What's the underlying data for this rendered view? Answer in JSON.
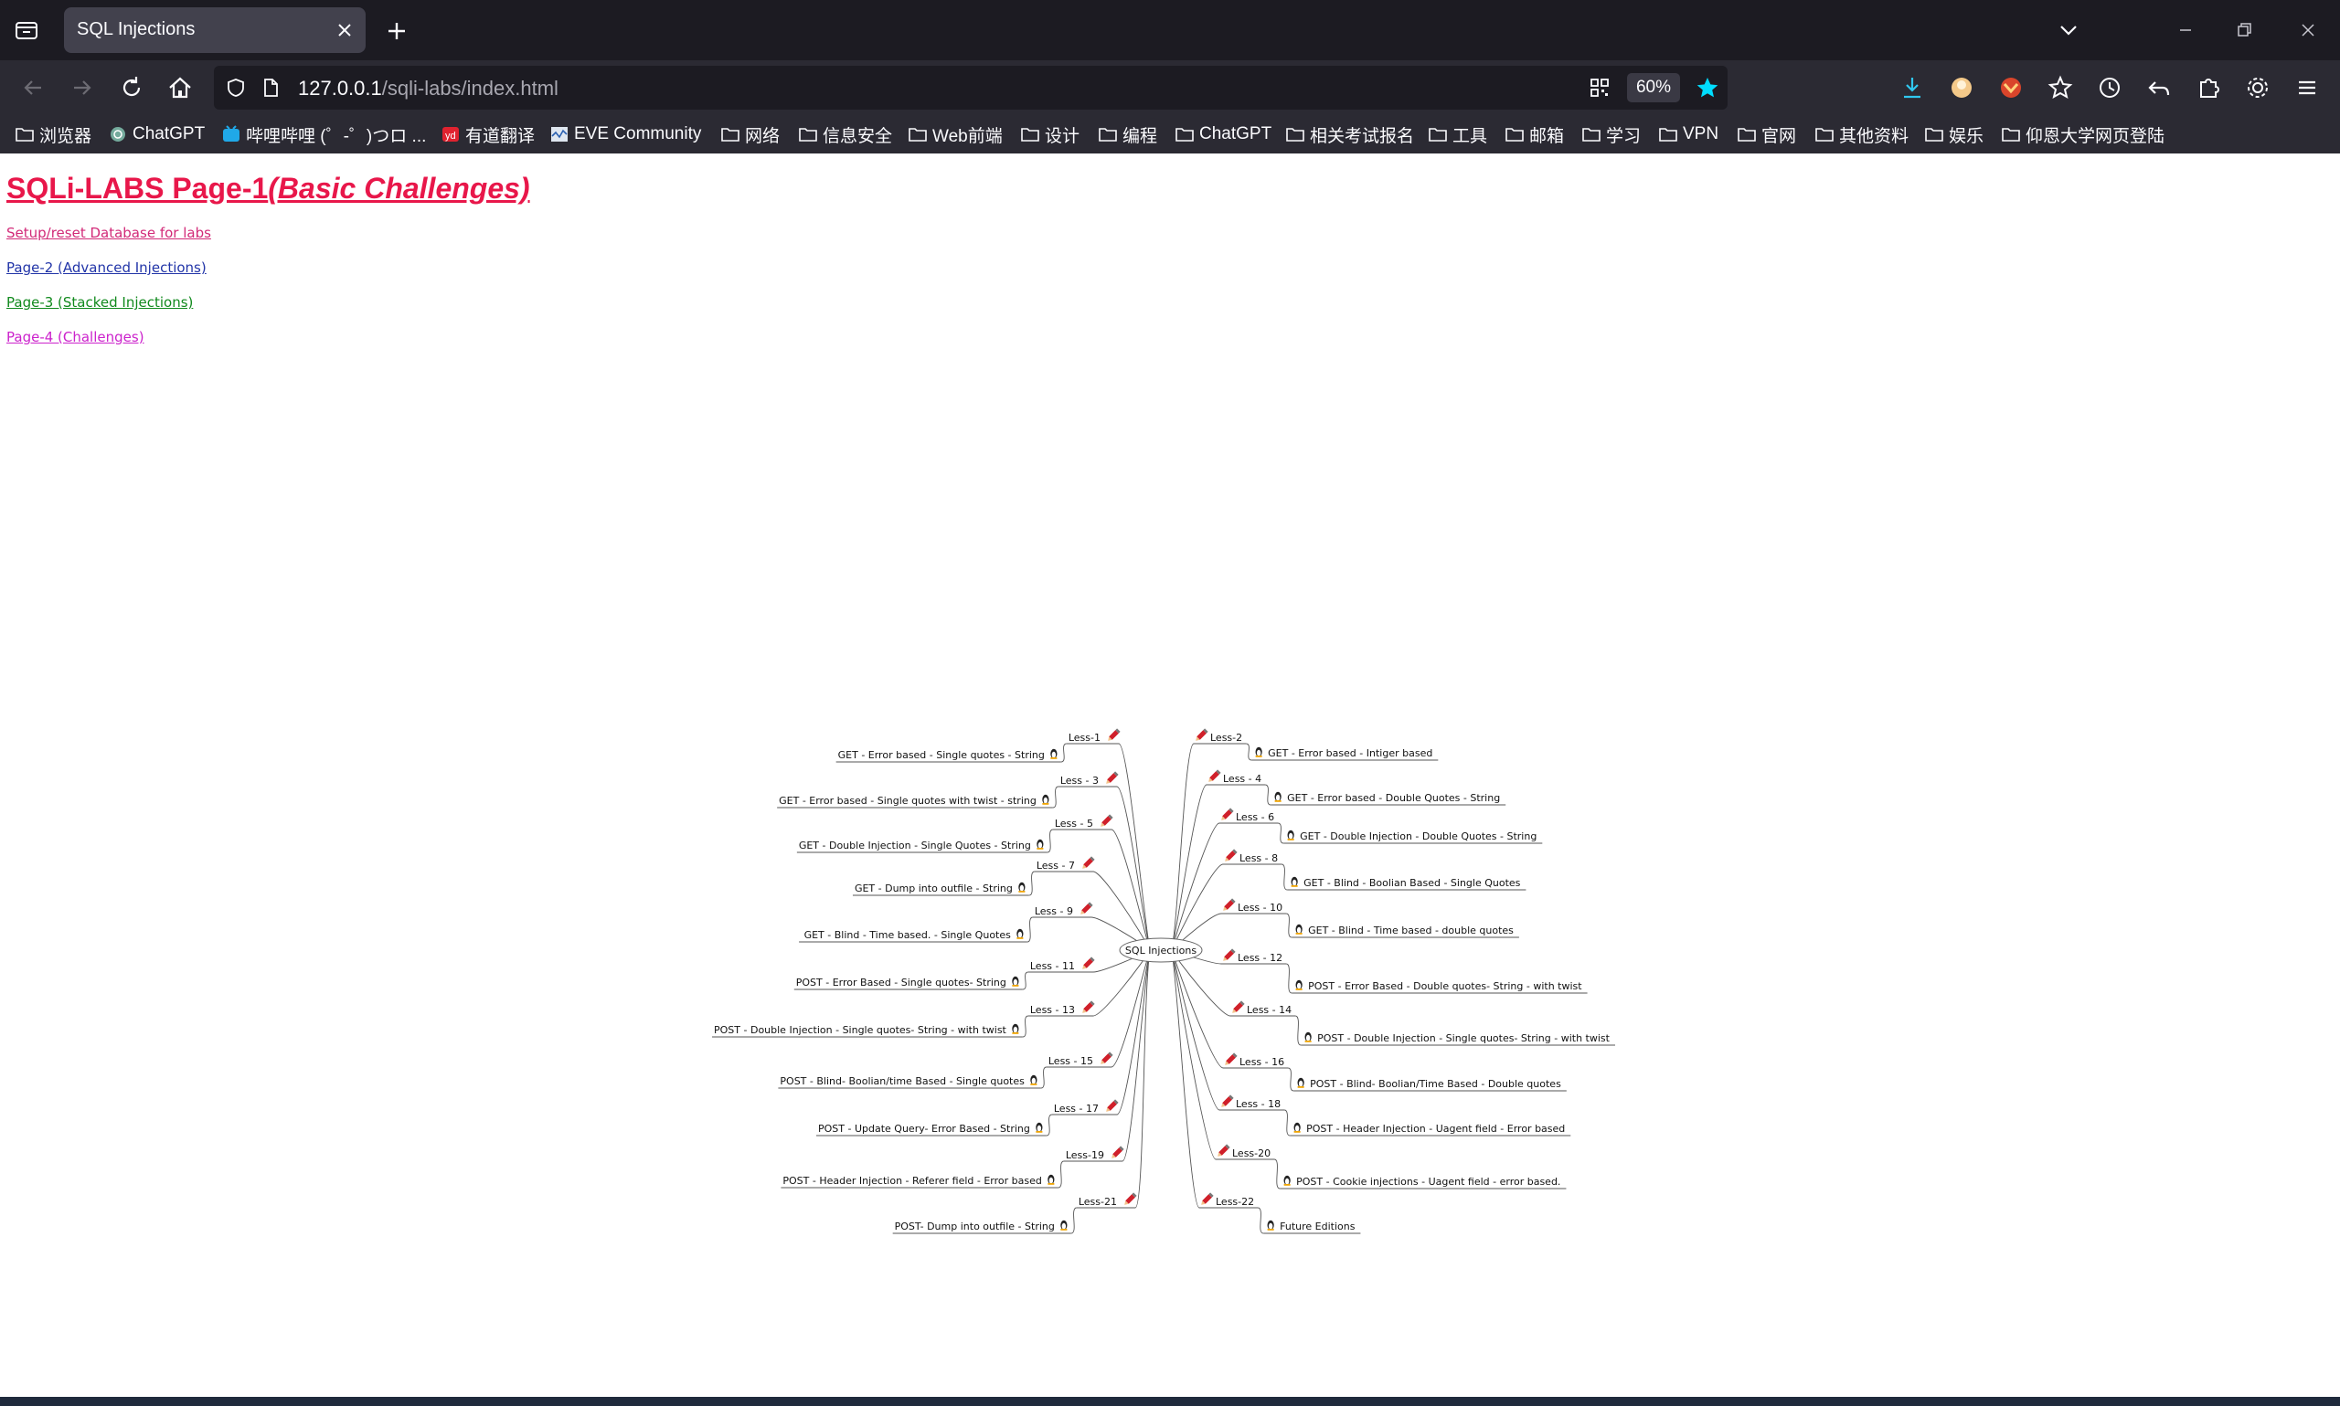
{
  "browser": {
    "tab_title": "SQL Injections",
    "url_host": "127.0.0.1",
    "url_path": "/sqli-labs/index.html",
    "zoom": "60%",
    "bookmarks": [
      {
        "label": "浏览器",
        "icon": "folder-icon"
      },
      {
        "label": "ChatGPT",
        "icon": "chatgpt-icon"
      },
      {
        "label": "哔哩哔哩 (゜-゜)つロ ...",
        "icon": "bilibili-icon"
      },
      {
        "label": "有道翻译",
        "icon": "youdao-icon"
      },
      {
        "label": "EVE Community",
        "icon": "eve-icon"
      },
      {
        "label": "网络",
        "icon": "folder-icon"
      },
      {
        "label": "信息安全",
        "icon": "folder-icon"
      },
      {
        "label": "Web前端",
        "icon": "folder-icon"
      },
      {
        "label": "设计",
        "icon": "folder-icon"
      },
      {
        "label": "编程",
        "icon": "folder-icon"
      },
      {
        "label": "ChatGPT",
        "icon": "folder-icon"
      },
      {
        "label": "相关考试报名",
        "icon": "folder-icon"
      },
      {
        "label": "工具",
        "icon": "folder-icon"
      },
      {
        "label": "邮箱",
        "icon": "folder-icon"
      },
      {
        "label": "学习",
        "icon": "folder-icon"
      },
      {
        "label": "VPN",
        "icon": "folder-icon"
      },
      {
        "label": "官网",
        "icon": "folder-icon"
      },
      {
        "label": "其他资料",
        "icon": "folder-icon"
      },
      {
        "label": "娱乐",
        "icon": "folder-icon"
      },
      {
        "label": "仰恩大学网页登陆",
        "icon": "folder-icon"
      }
    ],
    "accent_color": "#00ddff"
  },
  "page": {
    "heading_main": "SQLi-LABS Page-1",
    "heading_italic": "(Basic Challenges)",
    "links": {
      "setup": "Setup/reset Database for labs",
      "page2": "Page-2 (Advanced Injections)",
      "page3": "Page-3 (Stacked Injections)",
      "page4": "Page-4 (Challenges)"
    },
    "colors": {
      "heading": "#e8174a",
      "setup": "#d22a78",
      "page2": "#2235a8",
      "page3": "#118a1d",
      "page4": "#cc22cc"
    }
  },
  "mindmap": {
    "root": "SQL Injections",
    "left": [
      {
        "lesson": "Less-1",
        "title": "GET - Error based - Single quotes - String"
      },
      {
        "lesson": "Less - 3",
        "title": "GET - Error based - Single quotes with twist - string"
      },
      {
        "lesson": "Less - 5",
        "title": "GET - Double Injection - Single Quotes - String"
      },
      {
        "lesson": "Less - 7",
        "title": "GET - Dump into outfile - String"
      },
      {
        "lesson": "Less - 9",
        "title": "GET - Blind - Time based. -  Single Quotes"
      },
      {
        "lesson": "Less - 11",
        "title": "POST - Error Based - Single quotes- String"
      },
      {
        "lesson": "Less - 13",
        "title": "POST - Double Injection - Single quotes- String - with twist"
      },
      {
        "lesson": "Less - 15",
        "title": "POST - Blind- Boolian/time Based - Single quotes"
      },
      {
        "lesson": "Less - 17",
        "title": "POST - Update Query- Error Based - String"
      },
      {
        "lesson": "Less-19",
        "title": "POST - Header Injection - Referer field - Error based"
      },
      {
        "lesson": "Less-21",
        "title": "POST- Dump into outfile - String"
      }
    ],
    "right": [
      {
        "lesson": "Less-2",
        "title": "GET - Error based - Intiger based"
      },
      {
        "lesson": "Less - 4",
        "title": "GET - Error based - Double Quotes - String"
      },
      {
        "lesson": "Less - 6",
        "title": "GET - Double Injection - Double Quotes - String"
      },
      {
        "lesson": "Less - 8",
        "title": "GET - Blind - Boolian Based - Single Quotes"
      },
      {
        "lesson": "Less - 10",
        "title": "GET - Blind - Time based - double quotes"
      },
      {
        "lesson": "Less - 12",
        "title": "POST - Error Based - Double quotes- String - with twist"
      },
      {
        "lesson": "Less - 14",
        "title": "POST - Double Injection - Single quotes- String - with twist"
      },
      {
        "lesson": "Less - 16",
        "title": "POST - Blind- Boolian/Time Based - Double quotes"
      },
      {
        "lesson": "Less - 18",
        "title": "POST - Header Injection - Uagent field - Error based"
      },
      {
        "lesson": "Less-20",
        "title": "POST - Cookie injections - Uagent field - error based."
      },
      {
        "lesson": "Less-22",
        "title": "Future Editions"
      }
    ]
  }
}
